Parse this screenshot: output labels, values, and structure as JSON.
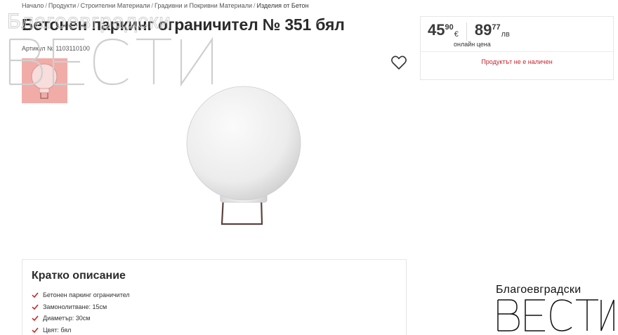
{
  "breadcrumb": {
    "items": [
      "Начало",
      "Продукти",
      "Строителни Материали",
      "Градивни и Покривни Материали"
    ],
    "current": "Изделия от Бетон",
    "separator": "/"
  },
  "product": {
    "title": "Бетонен паркинг ограничител № 351 бял",
    "sku": "Артикул № 1103110100"
  },
  "price": {
    "eur_int": "45",
    "eur_dec": "90",
    "eur_currency": "€",
    "bgn_int": "89",
    "bgn_dec": "77",
    "bgn_currency": "лв",
    "online_label": "онлайн цена",
    "stock_status": "Продуктът не е наличен"
  },
  "description": {
    "title": "Кратко описание",
    "items": [
      "Бетонен паркинг ограничител",
      "Замонолитване: 15см",
      "Диаметър: 30см",
      "Цвят: бял"
    ]
  },
  "watermark": {
    "top_line": "Благоевградски",
    "bottom_line": "ВЕСТИ"
  },
  "icons": {
    "favorite": "heart-icon",
    "check": "check-icon"
  },
  "colors": {
    "accent_red": "#c8232c",
    "thumb_bg": "#f1a8a4",
    "text_dark": "#2b2b2b"
  }
}
